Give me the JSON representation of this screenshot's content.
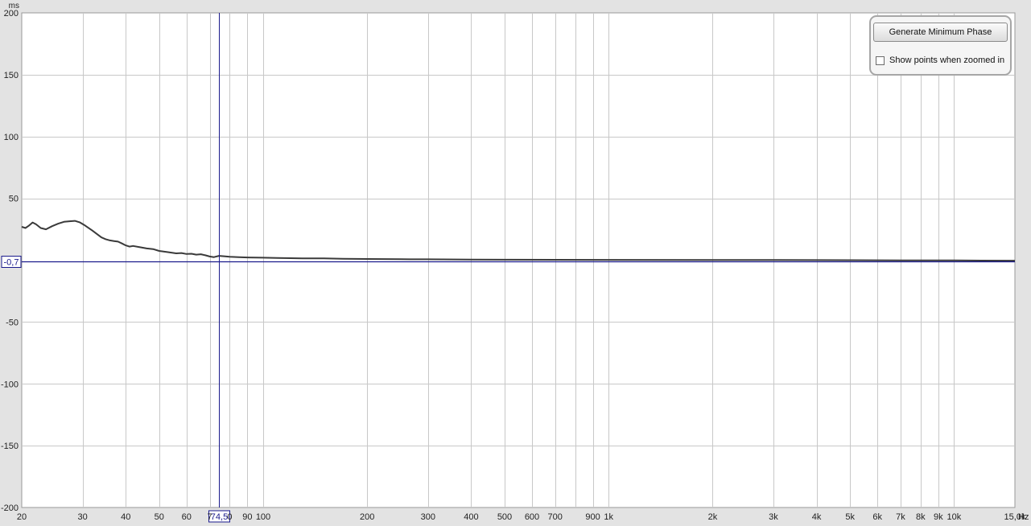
{
  "chart_data": {
    "type": "line",
    "title": "",
    "y_unit": "ms",
    "x_unit": "Hz",
    "x_scale": "log",
    "xlim": [
      20,
      15000
    ],
    "ylim": [
      -200,
      200
    ],
    "x_ticks": [
      {
        "value": 20,
        "label": "20"
      },
      {
        "value": 30,
        "label": "30"
      },
      {
        "value": 40,
        "label": "40"
      },
      {
        "value": 50,
        "label": "50"
      },
      {
        "value": 60,
        "label": "60"
      },
      {
        "value": 70,
        "label": "7"
      },
      {
        "value": 80,
        "label": "0"
      },
      {
        "value": 90,
        "label": "90"
      },
      {
        "value": 100,
        "label": "100"
      },
      {
        "value": 200,
        "label": "200"
      },
      {
        "value": 300,
        "label": "300"
      },
      {
        "value": 400,
        "label": "400"
      },
      {
        "value": 500,
        "label": "500"
      },
      {
        "value": 600,
        "label": "600"
      },
      {
        "value": 700,
        "label": "700"
      },
      {
        "value": 900,
        "label": "900"
      },
      {
        "value": 1000,
        "label": "1k"
      },
      {
        "value": 2000,
        "label": "2k"
      },
      {
        "value": 3000,
        "label": "3k"
      },
      {
        "value": 4000,
        "label": "4k"
      },
      {
        "value": 5000,
        "label": "5k"
      },
      {
        "value": 6000,
        "label": "6k"
      },
      {
        "value": 7000,
        "label": "7k"
      },
      {
        "value": 8000,
        "label": "8k"
      },
      {
        "value": 9000,
        "label": "9k"
      },
      {
        "value": 10000,
        "label": "10k"
      },
      {
        "value": 15000,
        "label": "15,0k"
      }
    ],
    "x_grid_minor": [
      800
    ],
    "y_ticks": [
      {
        "value": 200,
        "label": "200"
      },
      {
        "value": 150,
        "label": "150"
      },
      {
        "value": 100,
        "label": "100"
      },
      {
        "value": 50,
        "label": "50"
      },
      {
        "value": -50,
        "label": "-50"
      },
      {
        "value": -100,
        "label": "-100"
      },
      {
        "value": -150,
        "label": "-150"
      },
      {
        "value": -200,
        "label": "-200"
      }
    ],
    "grid": true,
    "series": [
      {
        "color": "#3a3a3a",
        "x": [
          20,
          20.5,
          21,
          21.5,
          22,
          22.7,
          23.5,
          24.5,
          25.5,
          26.5,
          27.5,
          28.5,
          29.5,
          30.5,
          32,
          34,
          35,
          36,
          37,
          38,
          39,
          40,
          41,
          42,
          44,
          46,
          48,
          50,
          53,
          56,
          58,
          60,
          62,
          64,
          66,
          68,
          70,
          72,
          74.5,
          77,
          80,
          85,
          90,
          100,
          110,
          120,
          130,
          150,
          170,
          200,
          250,
          300,
          400,
          500,
          700,
          1000,
          2000,
          3000,
          5000,
          7000,
          10000,
          12000,
          15000
        ],
        "y": [
          27,
          26,
          28,
          30.5,
          29,
          26,
          25,
          27.5,
          29.5,
          31,
          31.5,
          31.8,
          30.5,
          28,
          24,
          18.5,
          17,
          16,
          15.5,
          15,
          13.5,
          12,
          11,
          11.5,
          10.5,
          9.5,
          9,
          7.5,
          6.5,
          5.5,
          5.8,
          5,
          5.2,
          4.5,
          4.8,
          4,
          3,
          2.5,
          3.5,
          3.2,
          2.8,
          2.5,
          2.2,
          2,
          1.8,
          1.6,
          1.5,
          1.4,
          1.2,
          1,
          0.8,
          0.7,
          0.5,
          0.4,
          0.3,
          0.25,
          0.2,
          0.1,
          0,
          -0.1,
          -0.2,
          -0.3,
          -0.4
        ]
      }
    ],
    "cursor": {
      "x": 74.5,
      "y": -0.7,
      "x_label": "74,5",
      "y_label": "-0,7",
      "color": "#1a1a8c"
    },
    "colors": {
      "background": "#ffffff",
      "grid": "#c8c8c8",
      "frame": "#9a9a9a"
    }
  },
  "panel": {
    "generate_button_label": "Generate Minimum Phase",
    "show_points_label": "Show points when zoomed in",
    "show_points_checked": false
  }
}
